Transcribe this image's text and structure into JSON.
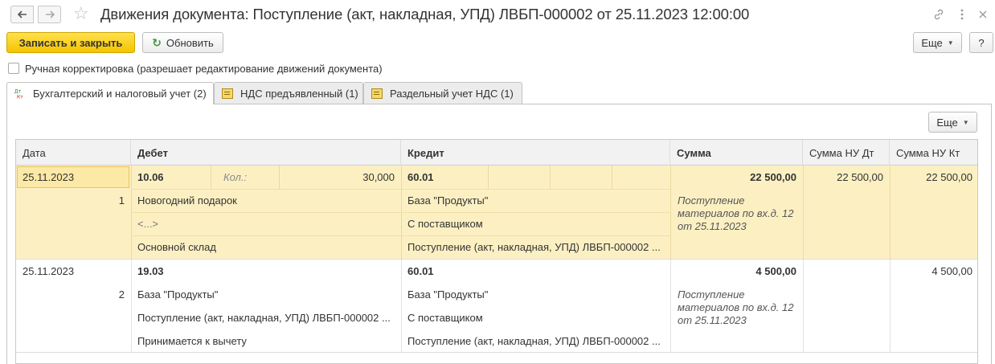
{
  "window": {
    "title": "Движения документа: Поступление (акт, накладная, УПД) ЛВБП-000002 от 25.11.2023 12:00:00"
  },
  "icons": {
    "back": "arrow-left-icon",
    "forward": "arrow-right-icon",
    "favorite": "star-icon",
    "link": "link-icon",
    "menu": "more-vertical-icon",
    "close": "close-icon"
  },
  "toolbar": {
    "write_close_label": "Записать и закрыть",
    "refresh_label": "Обновить",
    "more_label": "Еще",
    "help_label": "?"
  },
  "manual_correction": {
    "label": "Ручная корректировка (разрешает редактирование движений документа)",
    "checked": false
  },
  "tabs": [
    {
      "label": "Бухгалтерский и налоговый учет (2)",
      "active": true
    },
    {
      "label": "НДС предъявленный (1)",
      "active": false
    },
    {
      "label": "Раздельный учет НДС (1)",
      "active": false
    }
  ],
  "grid": {
    "more_label": "Еще",
    "columns": [
      "Дата",
      "Дебет",
      "Кредит",
      "Сумма",
      "Сумма НУ Дт",
      "Сумма НУ Кт"
    ],
    "rows": [
      {
        "date": "25.11.2023",
        "num": "1",
        "debit_account": "10.06",
        "qty_label": "Кол.:",
        "qty_value": "30,000",
        "debit_sub1": "Новогодний подарок",
        "debit_sub2": "<...>",
        "debit_sub3": "Основной склад",
        "credit_account": "60.01",
        "credit_sub1": "База \"Продукты\"",
        "credit_sub2": "С поставщиком",
        "credit_sub3": "Поступление (акт, накладная, УПД) ЛВБП-000002 ...",
        "sum": "22 500,00",
        "content_l1": "Поступление",
        "content_l2": "материалов по вх.д. 12",
        "content_l3": "от 25.11.2023",
        "sum_nu_dt": "22 500,00",
        "sum_nu_kt": "22 500,00"
      },
      {
        "date": "25.11.2023",
        "num": "2",
        "debit_account": "19.03",
        "debit_sub1": "База \"Продукты\"",
        "debit_sub2": "Поступление (акт, накладная, УПД) ЛВБП-000002 ...",
        "debit_sub3": "Принимается к вычету",
        "credit_account": "60.01",
        "credit_sub1": "База \"Продукты\"",
        "credit_sub2": "С поставщиком",
        "credit_sub3": "Поступление (акт, накладная, УПД) ЛВБП-000002 ...",
        "sum": "4 500,00",
        "content_l1": "Поступление",
        "content_l2": "материалов по вх.д. 12",
        "content_l3": "от 25.11.2023",
        "sum_nu_dt": "",
        "sum_nu_kt": "4 500,00"
      }
    ]
  },
  "colors": {
    "primary_button": "#f5c400",
    "selected_row": "#fcf0c3",
    "refresh_icon": "#3d9a3d"
  }
}
